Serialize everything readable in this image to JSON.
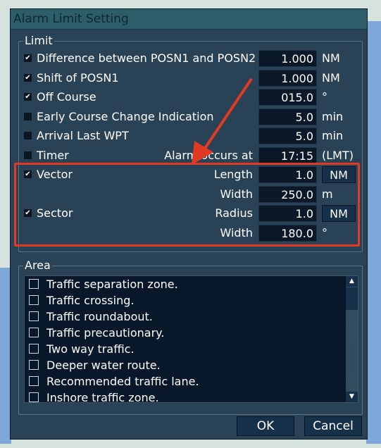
{
  "dialog": {
    "title": "Alarm Limit Setting"
  },
  "limit": {
    "label": "Limit",
    "rows": [
      {
        "label": "Difference between POSN1 and POSN2",
        "checked": true,
        "value": "1.000",
        "unit": "NM"
      },
      {
        "label": "Shift of POSN1",
        "checked": true,
        "value": "1.000",
        "unit": "NM"
      },
      {
        "label": "Off Course",
        "checked": true,
        "value": "015.0",
        "unit": "°"
      },
      {
        "label": "Early Course Change Indication",
        "checked": false,
        "value": "5.0",
        "unit": "min"
      },
      {
        "label": "Arrival Last WPT",
        "checked": false,
        "value": "5.0",
        "unit": "min"
      },
      {
        "label": "Timer",
        "checked": false,
        "sublabel": "Alarm occurs at",
        "value": "17:15",
        "unit": "(LMT)"
      }
    ],
    "vector": {
      "label": "Vector",
      "checked": true,
      "length_label": "Length",
      "length": "1.0",
      "length_unit": "NM",
      "width_label": "Width",
      "width": "250.0",
      "width_unit": "m"
    },
    "sector": {
      "label": "Sector",
      "checked": true,
      "radius_label": "Radius",
      "radius": "1.0",
      "radius_unit": "NM",
      "width_label": "Width",
      "width": "180.0",
      "width_unit": "°"
    }
  },
  "area": {
    "label": "Area",
    "items": [
      "Traffic separation zone.",
      "Traffic crossing.",
      "Traffic roundabout.",
      "Traffic precautionary.",
      "Two way traffic.",
      "Deeper water route.",
      "Recommended traffic lane.",
      "Inshore traffic zone."
    ]
  },
  "buttons": {
    "ok": "OK",
    "cancel": "Cancel"
  },
  "colors": {
    "highlight": "#e03a22",
    "title_bar": "#2d5d68",
    "dialog_bg": "#2a4256"
  }
}
